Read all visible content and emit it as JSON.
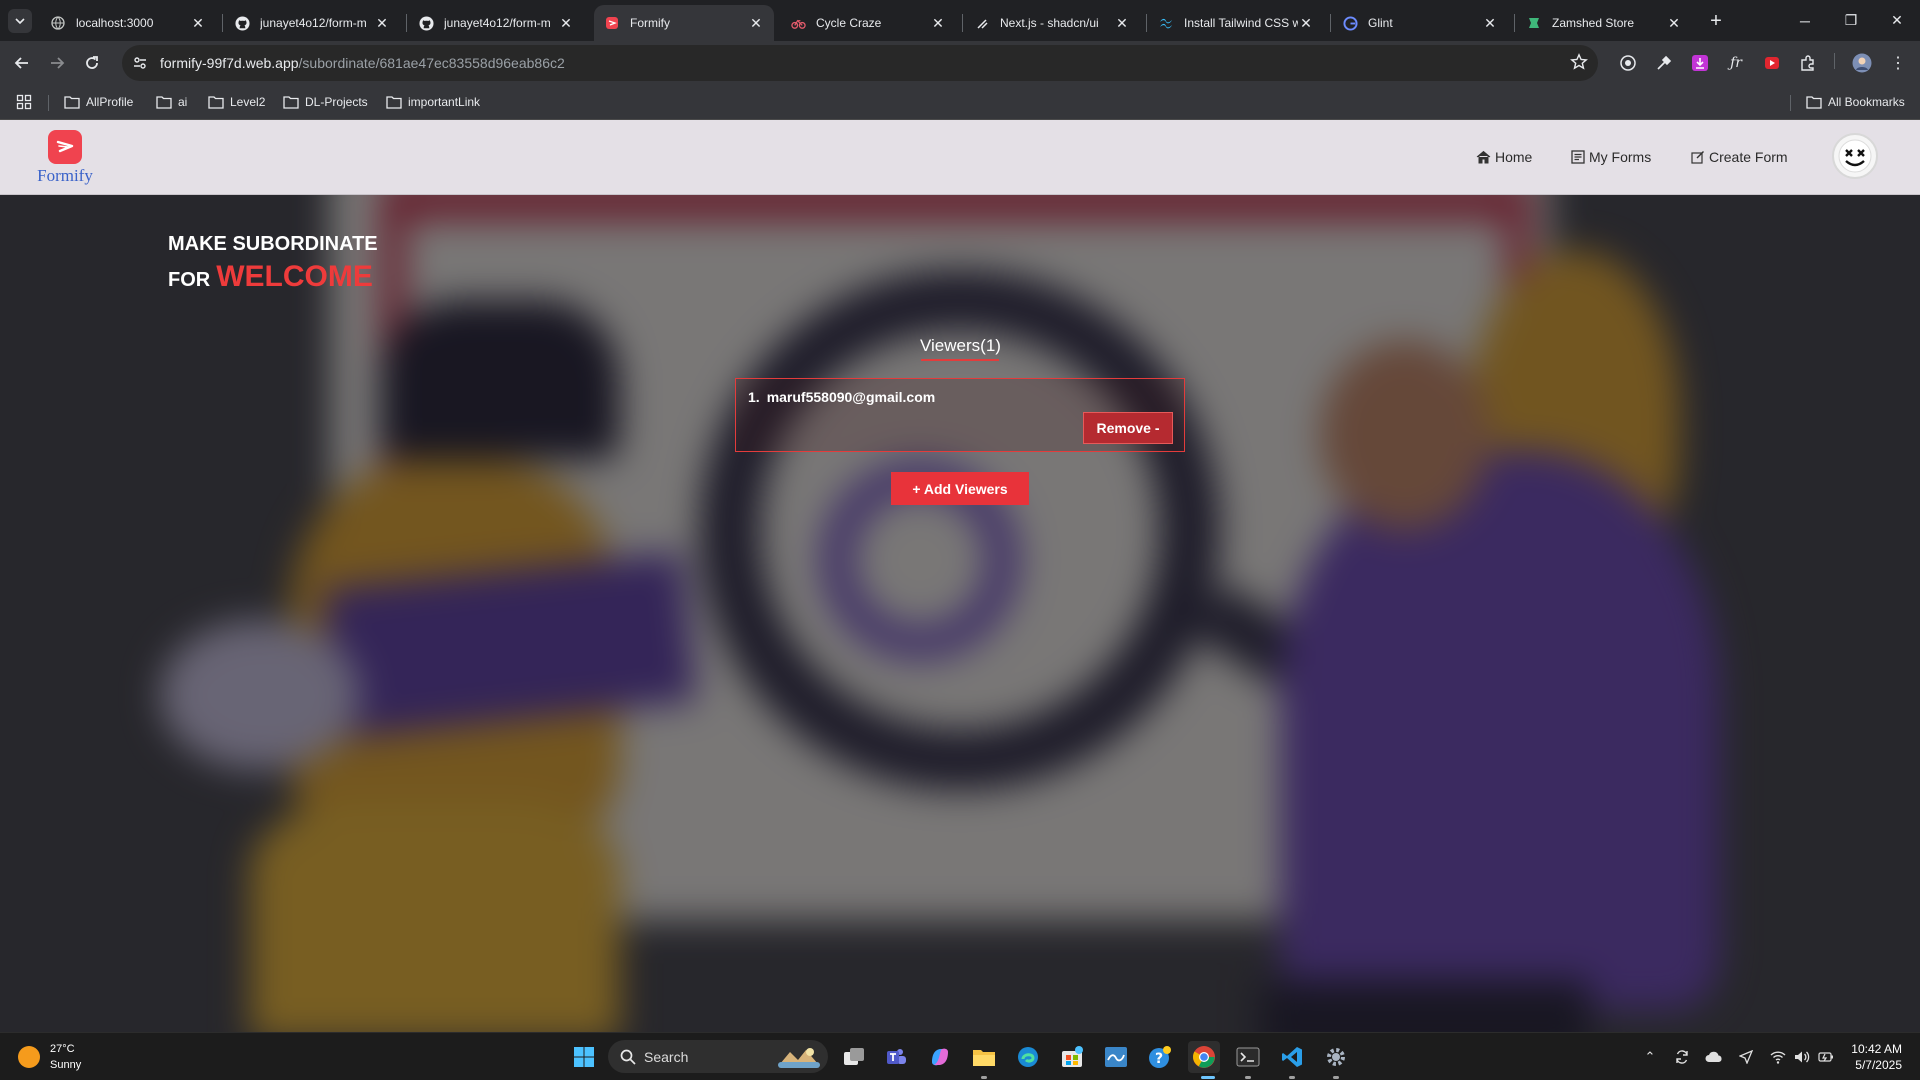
{
  "browser": {
    "tabs": [
      {
        "title": "localhost:3000"
      },
      {
        "title": "junayet4o12/form-m"
      },
      {
        "title": "junayet4o12/form-m"
      },
      {
        "title": "Formify"
      },
      {
        "title": "Cycle Craze"
      },
      {
        "title": "Next.js - shadcn/ui"
      },
      {
        "title": "Install Tailwind CSS w"
      },
      {
        "title": "Glint"
      },
      {
        "title": "Zamshed Store"
      }
    ],
    "url_host": "formify-99f7d.web.app",
    "url_path": "/subordinate/681ae47ec83558d96eab86c2",
    "bookmarks": [
      "AllProfile",
      "ai",
      "Level2",
      "DL-Projects",
      "importantLink"
    ],
    "all_bookmarks": "All Bookmarks"
  },
  "app": {
    "brand": "Formify",
    "nav": {
      "home": "Home",
      "my_forms": "My Forms",
      "create_form": "Create Form"
    },
    "headline_line1": "MAKE SUBORDINATE",
    "headline_for": "FOR",
    "headline_highlight": "WELCOME",
    "viewers_title": "Viewers(1)",
    "viewers": [
      {
        "index": "1.",
        "email": "maruf558090@gmail.com",
        "remove_label": "Remove -"
      }
    ],
    "add_viewers_label": "+ Add Viewers",
    "accent_color": "#e8333a"
  },
  "taskbar": {
    "temperature": "27°C",
    "weather": "Sunny",
    "search_label": "Search",
    "time": "10:42 AM",
    "date": "5/7/2025"
  }
}
